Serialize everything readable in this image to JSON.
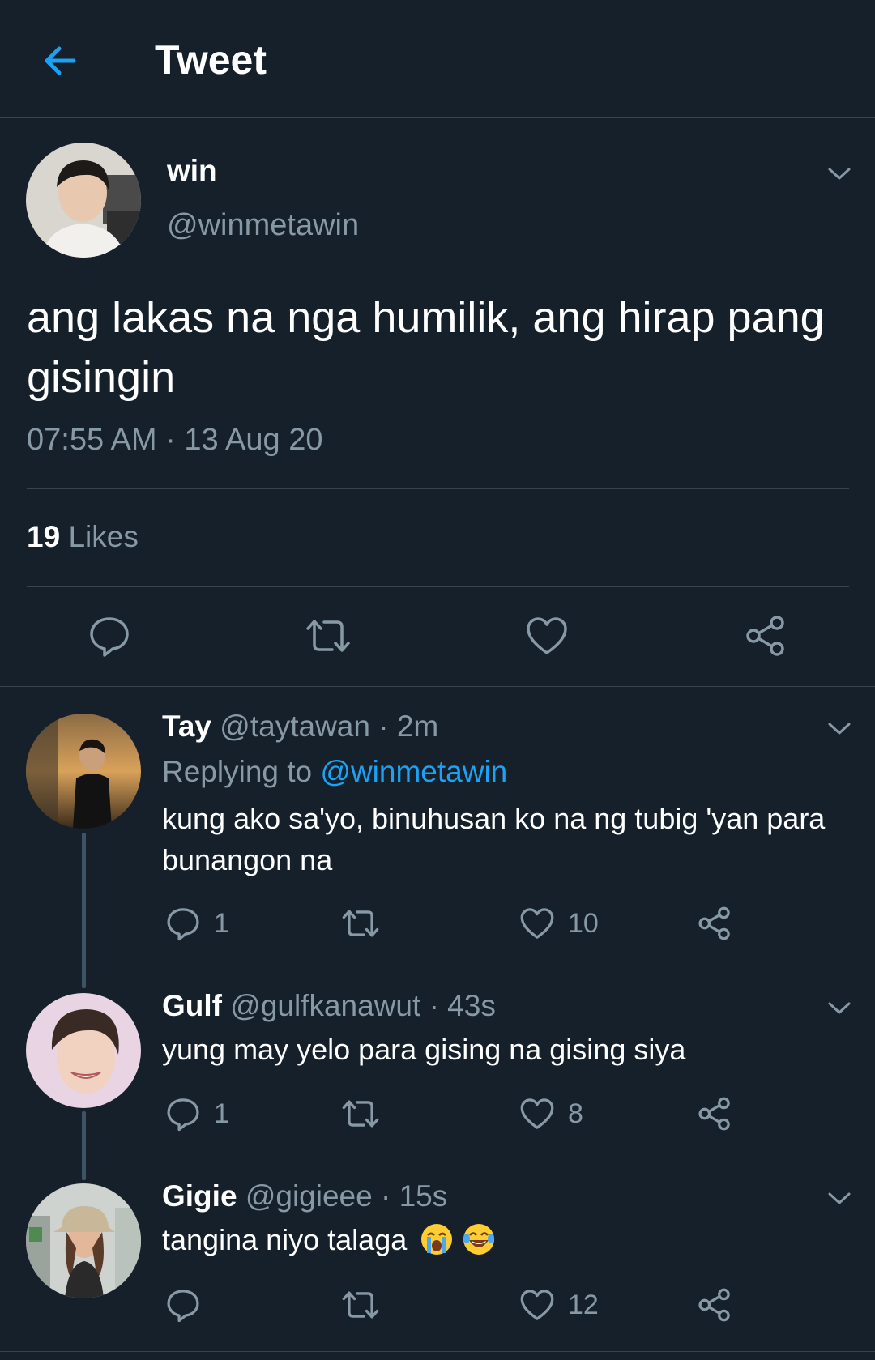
{
  "header": {
    "title": "Tweet"
  },
  "main_tweet": {
    "name": "win",
    "handle": "@winmetawin",
    "text": "ang lakas na nga humilik, ang hirap pang gisingin",
    "timestamp": "07:55 AM · 13 Aug 20",
    "likes_count": "19",
    "likes_label": "Likes"
  },
  "replies": [
    {
      "name": "Tay",
      "handle": "@taytawan",
      "time": "· 2m",
      "replying_prefix": "Replying to",
      "replying_to": "@winmetawin",
      "text": "kung ako sa'yo, binuhusan ko na ng tubig 'yan para bunangon na",
      "reply_count": "1",
      "retweet_count": "",
      "like_count": "10"
    },
    {
      "name": "Gulf",
      "handle": "@gulfkanawut",
      "time": "· 43s",
      "text": "yung may yelo para gising na gising siya",
      "reply_count": "1",
      "retweet_count": "",
      "like_count": "8"
    },
    {
      "name": "Gigie",
      "handle": "@gigieee",
      "time": "· 15s",
      "text": "tangina niyo talaga",
      "emoji": [
        "loudly-crying-face",
        "face-with-tears-of-joy"
      ],
      "reply_count": "",
      "retweet_count": "",
      "like_count": "12"
    }
  ],
  "colors": {
    "background": "#15202b",
    "divider": "#38444d",
    "muted_text": "#8899a6",
    "accent": "#1da1f2",
    "text": "#ffffff"
  }
}
